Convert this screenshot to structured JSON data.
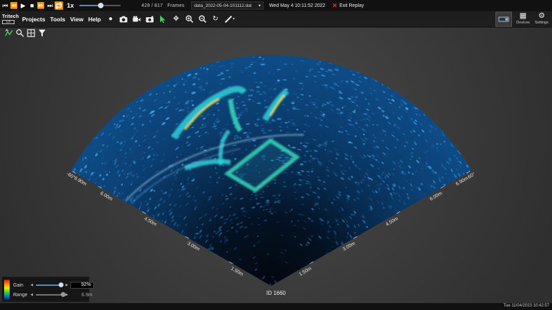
{
  "replay": {
    "speed": "1x",
    "progress": 0.52,
    "frame_current": "428",
    "frame_separator": "/",
    "frame_total": "817",
    "frames_label": "Frames",
    "file_name": "data_2022-05-04-101112.dat",
    "date_text": "Wed May 4 10:11:52 2022",
    "exit_label": "Exit Replay"
  },
  "menu": {
    "logo_brand": "Tritech",
    "logo_sub": "Gv",
    "items": [
      "Projects",
      "Tools",
      "View",
      "Help"
    ]
  },
  "right_buttons": {
    "devices_label": "Devices",
    "settings_label": "Settings"
  },
  "sonar": {
    "angle_left": "-60°",
    "angle_right": "60°",
    "left_ranges": [
      "6.90m",
      "6.00m",
      "4.50m",
      "3.00m",
      "1.50m"
    ],
    "right_ranges": [
      "6.90m",
      "6.00m",
      "4.50m",
      "3.00m",
      "1.50m"
    ],
    "device_id": "ID 1660"
  },
  "controls": {
    "gain_label": "Gain",
    "gain_value": "92%",
    "gain_level": 0.92,
    "range_label": "Range",
    "range_value": "6.9m",
    "range_level": 1.0
  },
  "status": {
    "time": "Tue 11/04/2023 10:42:57"
  },
  "colors": {
    "accent": "#4a8fd6",
    "tool_green": "#3fd24f",
    "exit_red": "#e03232"
  }
}
